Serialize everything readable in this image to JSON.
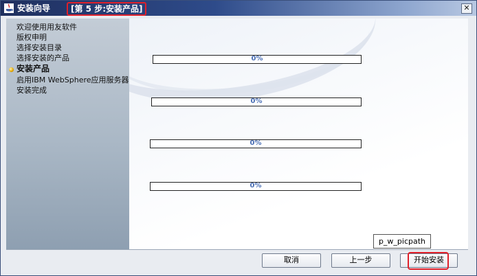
{
  "window": {
    "title": "安装向导",
    "step_label": "[第 5 步:安装产品]",
    "close_symbol": "✕"
  },
  "sidebar": {
    "items": [
      {
        "label": "欢迎使用用友软件",
        "active": false
      },
      {
        "label": "版权申明",
        "active": false
      },
      {
        "label": "选择安装目录",
        "active": false
      },
      {
        "label": "选择安装的产品",
        "active": false
      },
      {
        "label": "安装产品",
        "active": true
      },
      {
        "label": "启用IBM WebSphere应用服务器",
        "active": false
      },
      {
        "label": "安装完成",
        "active": false
      }
    ]
  },
  "progress_bars": [
    {
      "text": "0%",
      "value": 0
    },
    {
      "text": "0%",
      "value": 0
    },
    {
      "text": "0%",
      "value": 0
    },
    {
      "text": "0%",
      "value": 0
    }
  ],
  "buttons": {
    "cancel": "取消",
    "back": "上一步",
    "start_install": "开始安装"
  },
  "tooltip": "p_w_picpath",
  "colors": {
    "highlight": "#e0202a",
    "progress_text": "#4a6fb5"
  }
}
